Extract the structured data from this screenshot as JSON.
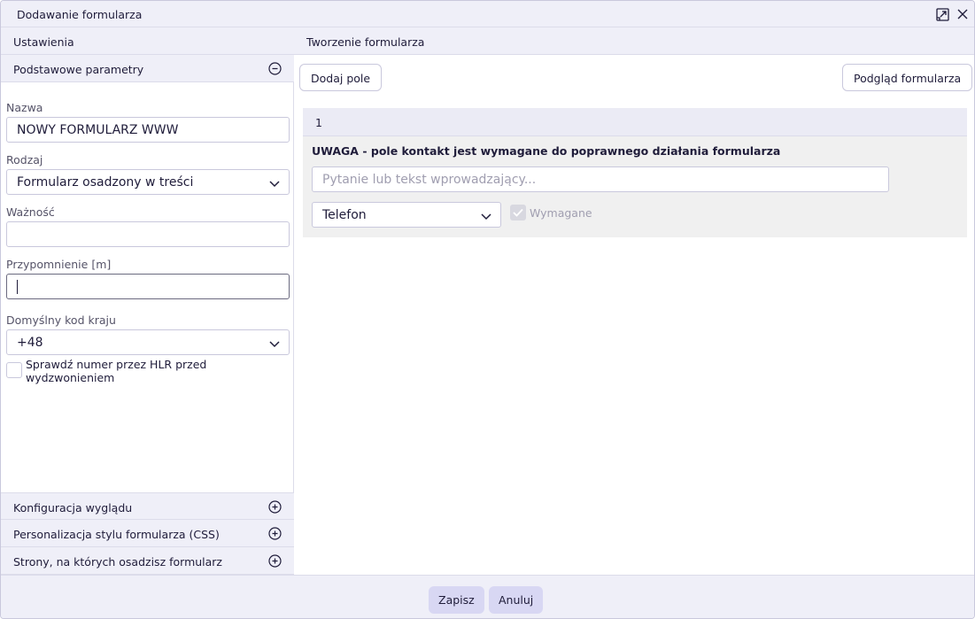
{
  "window": {
    "title": "Dodawanie formularza",
    "icons": {
      "expand": "expand-icon",
      "close": "close-icon"
    }
  },
  "settings_panel": {
    "header": "Ustawienia",
    "section_basic": {
      "title": "Podstawowe parametry",
      "icon": "minus-circle-icon",
      "name_label": "Nazwa",
      "name_value": "NOWY FORMULARZ WWW",
      "type_label": "Rodzaj",
      "type_value": "Formularz osadzony w treści",
      "validity_label": "Ważność",
      "validity_value": "",
      "reminder_label": "Przypomnienie [m]",
      "reminder_value": "",
      "country_code_label": "Domyślny kod kraju",
      "country_code_value": "+48",
      "hlr_check_label_line1": "Sprawdź numer przez HLR przed",
      "hlr_check_label_line2": "wydzwonieniem"
    },
    "collapsed_sections": [
      {
        "title": "Konfiguracja wyglądu",
        "icon": "plus-circle-icon"
      },
      {
        "title": "Personalizacja stylu formularza (CSS)",
        "icon": "plus-circle-icon"
      },
      {
        "title": "Strony, na których osadzisz formularz",
        "icon": "plus-circle-icon"
      }
    ]
  },
  "builder_panel": {
    "header": "Tworzenie formularza",
    "add_field_button": "Dodaj pole",
    "preview_button": "Podgląd formularza",
    "fields": [
      {
        "number": "1",
        "warning": "UWAGA - pole kontakt jest wymagane do poprawnego działania formularza",
        "question_placeholder": "Pytanie lub tekst wprowadzający...",
        "field_type": "Telefon",
        "required_label": "Wymagane",
        "required_checked": true
      }
    ]
  },
  "footer": {
    "save_button": "Zapisz",
    "cancel_button": "Anuluj"
  },
  "colors": {
    "header_bg": "#efeff8",
    "primary_button_bg": "#d8d7f3",
    "text": "#1f1c3a",
    "border": "#c9c8dc"
  }
}
